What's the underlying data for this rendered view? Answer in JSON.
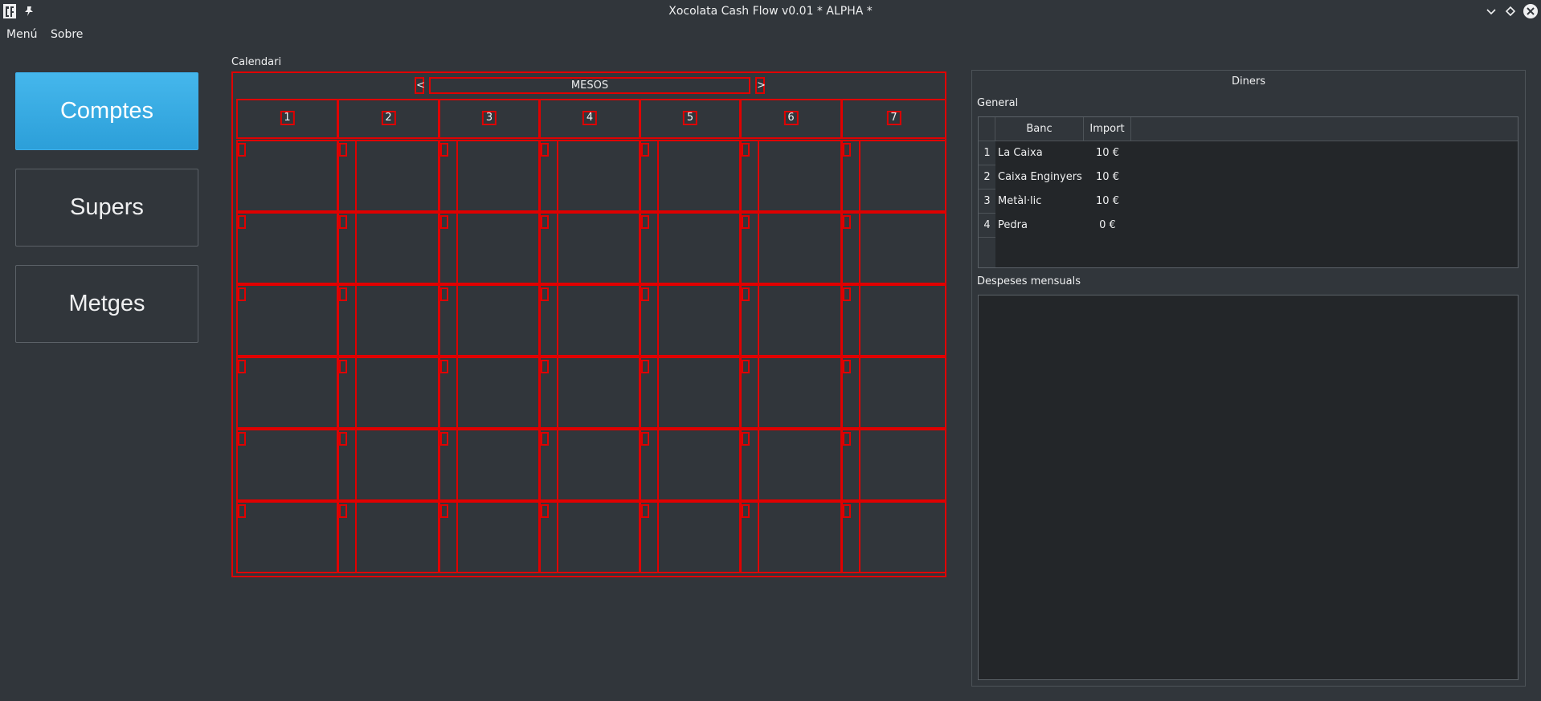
{
  "window": {
    "title": "Xocolata Cash Flow v0.01 * ALPHA *"
  },
  "menubar": {
    "items": [
      "Menú",
      "Sobre"
    ]
  },
  "sidebar": {
    "buttons": [
      "Comptes",
      "Supers",
      "Metges"
    ],
    "active": "Comptes"
  },
  "calendar": {
    "label": "Calendari",
    "prev": "<",
    "next": ">",
    "month": "MESOS",
    "days": [
      "1",
      "2",
      "3",
      "4",
      "5",
      "6",
      "7"
    ],
    "rows": 6
  },
  "money": {
    "title": "Diners",
    "general_label": "General",
    "columns": [
      "Banc",
      "Import"
    ],
    "rows": [
      {
        "n": "1",
        "bank": "La Caixa",
        "amount": "10 €"
      },
      {
        "n": "2",
        "bank": "Caixa Enginyers",
        "amount": "10 €"
      },
      {
        "n": "3",
        "bank": "Metàl·lic",
        "amount": "10 €"
      },
      {
        "n": "4",
        "bank": "Pedra",
        "amount": "0 €"
      }
    ],
    "monthly_label": "Despeses mensuals"
  },
  "colors": {
    "accent": "#3daee9",
    "background": "#31363b",
    "grid": "#e00000"
  }
}
